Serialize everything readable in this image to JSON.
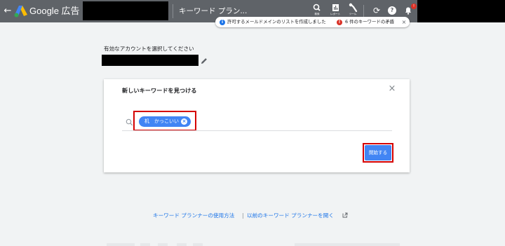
{
  "header": {
    "brand": "Google 広告",
    "tool_title": "キーワード プラン...",
    "tools": [
      {
        "icon": "search-icon",
        "label": "検索"
      },
      {
        "icon": "reports-icon",
        "label": "レポート"
      },
      {
        "icon": "wrench-icon",
        "label": "ツール"
      }
    ],
    "notification_badge": "!"
  },
  "notification": {
    "info_text": "許可するメールドメインのリストを作成しました",
    "alert_text": "6 件のキーワードの矛盾"
  },
  "account": {
    "label": "有効なアカウントを選択してください"
  },
  "dialog": {
    "title": "新しいキーワードを見つける",
    "chip_text": "机　かっこいい",
    "start_label": "開始する"
  },
  "footer": {
    "link_1": "キーワード プランナーの使用方法",
    "separator": "|",
    "link_2": "以前のキーワード プランナーを開く"
  },
  "colors": {
    "topbar": "#5f6368",
    "accent": "#4285f4",
    "highlight": "#d50000",
    "link": "#1a73e8"
  }
}
